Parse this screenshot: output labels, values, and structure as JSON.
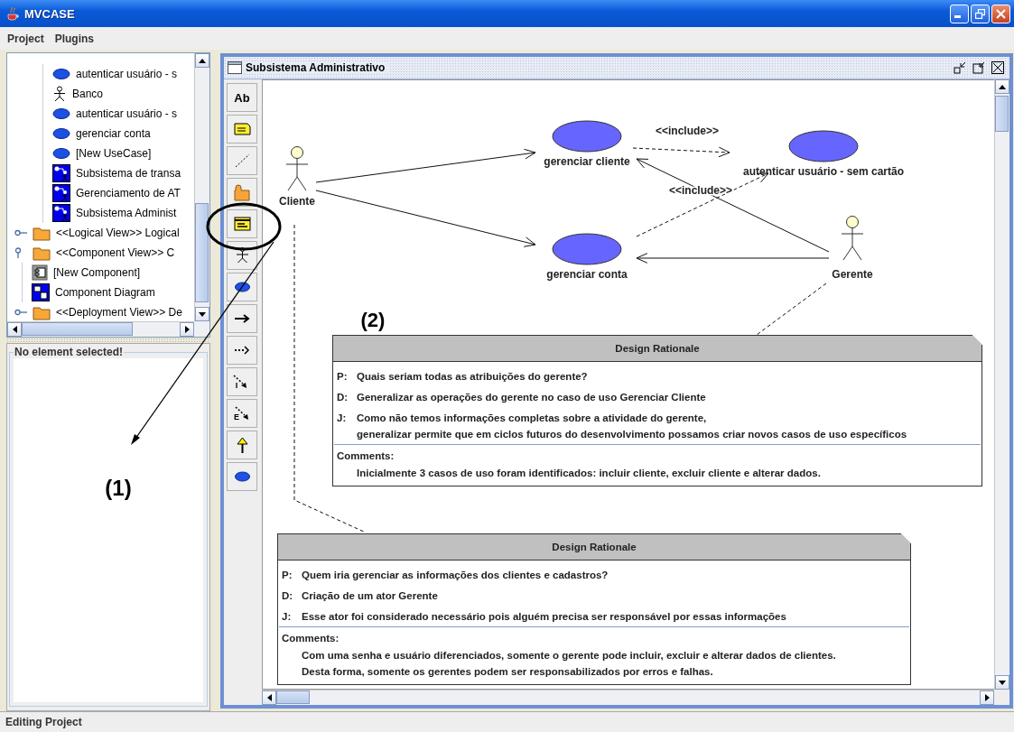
{
  "window": {
    "title": "MVCASE"
  },
  "menu": [
    {
      "label": "Project"
    },
    {
      "label": "Plugins"
    }
  ],
  "tree": {
    "continued_children": [
      {
        "kind": "usecase",
        "label": "autenticar usuário - s"
      },
      {
        "kind": "actor",
        "label": "Banco"
      },
      {
        "kind": "usecase",
        "label": "autenticar usuário - s"
      },
      {
        "kind": "usecase",
        "label": "gerenciar conta"
      },
      {
        "kind": "usecase",
        "label": "[New UseCase]"
      },
      {
        "kind": "diagram",
        "label": "Subsistema de transa"
      },
      {
        "kind": "diagram",
        "label": "Gerenciamento de AT"
      },
      {
        "kind": "diagram",
        "label": "Subsistema Administ"
      }
    ],
    "items": [
      {
        "kind": "folder",
        "label": "<<Logical View>> Logical",
        "expanded": false
      },
      {
        "kind": "folder",
        "label": "<<Component View>> C",
        "expanded": true,
        "children": [
          {
            "kind": "component",
            "label": "[New Component]"
          },
          {
            "kind": "component-diagram",
            "label": "Component Diagram"
          }
        ]
      },
      {
        "kind": "folder",
        "label": "<<Deployment View>> De",
        "expanded": false
      }
    ]
  },
  "properties": {
    "title": "No element selected!"
  },
  "frame": {
    "title": "Subsistema Administrativo"
  },
  "toolbar": [
    {
      "kind": "text",
      "label": "Ab"
    },
    {
      "kind": "note"
    },
    {
      "kind": "dashed-line"
    },
    {
      "kind": "package"
    },
    {
      "kind": "rationale"
    },
    {
      "kind": "actor"
    },
    {
      "kind": "usecase"
    },
    {
      "kind": "association"
    },
    {
      "kind": "dependency"
    },
    {
      "kind": "include",
      "label": "I"
    },
    {
      "kind": "extend",
      "label": "E"
    },
    {
      "kind": "generalization"
    },
    {
      "kind": "usecase"
    }
  ],
  "diagram": {
    "actors": [
      {
        "name": "Cliente"
      },
      {
        "name": "Gerente"
      }
    ],
    "use_cases": [
      {
        "name": "gerenciar cliente"
      },
      {
        "name": "autenticar usuário - sem cartão"
      },
      {
        "name": "gerenciar conta"
      }
    ],
    "relations": [
      {
        "kind": "association"
      },
      {
        "kind": "association"
      },
      {
        "kind": "association"
      },
      {
        "kind": "association"
      },
      {
        "kind": "include",
        "label": "<<include>>"
      },
      {
        "kind": "include",
        "label": "<<include>>"
      },
      {
        "kind": "note-link"
      },
      {
        "kind": "note-link"
      }
    ],
    "notes": [
      {
        "title": "Design Rationale",
        "entries": [
          {
            "tag": "P:",
            "lines": [
              "Quais seriam todas as atribuições do gerente?"
            ]
          },
          {
            "tag": "D:",
            "lines": [
              "Generalizar as operações do gerente no caso de uso Gerenciar Cliente"
            ]
          },
          {
            "tag": "J:",
            "lines": [
              "Como não temos informações completas sobre a atividade do gerente,",
              "generalizar permite que em ciclos futuros do desenvolvimento possamos criar novos casos de uso específicos"
            ]
          }
        ],
        "comments_label": "Comments:",
        "comments": [
          "Inicialmente 3 casos de uso foram identificados: incluir cliente, excluir cliente e alterar dados."
        ]
      },
      {
        "title": "Design Rationale",
        "entries": [
          {
            "tag": "P:",
            "lines": [
              "Quem iria gerenciar as informações dos clientes e cadastros?"
            ]
          },
          {
            "tag": "D:",
            "lines": [
              "Criação de um ator Gerente"
            ]
          },
          {
            "tag": "J:",
            "lines": [
              "Esse ator foi considerado necessário pois alguém precisa ser responsável por essas informações"
            ]
          }
        ],
        "comments_label": "Comments:",
        "comments": [
          "Com uma senha e usuário diferenciados, somente o gerente pode incluir, excluir e alterar dados de clientes.",
          "Desta forma, somente os gerentes podem ser responsabilizados por erros e falhas."
        ]
      }
    ]
  },
  "annotations": [
    {
      "label": "(1)"
    },
    {
      "label": "(2)"
    }
  ],
  "status_bar": {
    "text": "Editing Project"
  }
}
